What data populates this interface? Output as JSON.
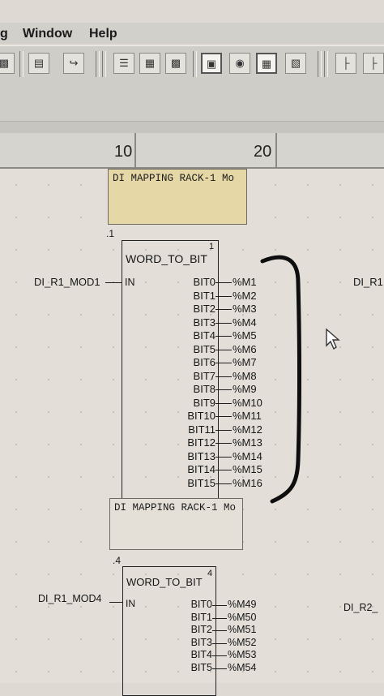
{
  "menu": {
    "items": [
      "g",
      "Window",
      "Help"
    ]
  },
  "toolbar": {
    "icons": [
      "console-icon",
      "print-icon",
      "import-icon",
      "layers-icon",
      "grid-icon",
      "grid-small-icon",
      "monitor-icon",
      "binoculars-icon",
      "table-icon",
      "save-icon",
      "tree-icon",
      "tree-alt-icon"
    ]
  },
  "ruler": {
    "marks": [
      "10",
      "20"
    ]
  },
  "comments": {
    "top": "DI MAPPING RACK-1 Mo",
    "middle": "DI MAPPING RACK-1 Mo"
  },
  "block1": {
    "rung_label": ".1",
    "name": "WORD_TO_BIT",
    "instance": "1",
    "input_label": "IN",
    "input_var": "DI_R1_MOD1",
    "right_var": "DI_R1",
    "pins": [
      {
        "bit": "BIT0",
        "mem": "%M1"
      },
      {
        "bit": "BIT1",
        "mem": "%M2"
      },
      {
        "bit": "BIT2",
        "mem": "%M3"
      },
      {
        "bit": "BIT3",
        "mem": "%M4"
      },
      {
        "bit": "BIT4",
        "mem": "%M5"
      },
      {
        "bit": "BIT5",
        "mem": "%M6"
      },
      {
        "bit": "BIT6",
        "mem": "%M7"
      },
      {
        "bit": "BIT7",
        "mem": "%M8"
      },
      {
        "bit": "BIT8",
        "mem": "%M9"
      },
      {
        "bit": "BIT9",
        "mem": "%M10"
      },
      {
        "bit": "BIT10",
        "mem": "%M11"
      },
      {
        "bit": "BIT11",
        "mem": "%M12"
      },
      {
        "bit": "BIT12",
        "mem": "%M13"
      },
      {
        "bit": "BIT13",
        "mem": "%M14"
      },
      {
        "bit": "BIT14",
        "mem": "%M15"
      },
      {
        "bit": "BIT15",
        "mem": "%M16"
      }
    ]
  },
  "block2": {
    "rung_label": ".4",
    "name": "WORD_TO_BIT",
    "instance": "4",
    "input_label": "IN",
    "input_var": "DI_R1_MOD4",
    "right_var": "DI_R2_",
    "pins": [
      {
        "bit": "BIT0",
        "mem": "%M49"
      },
      {
        "bit": "BIT1",
        "mem": "%M50"
      },
      {
        "bit": "BIT2",
        "mem": "%M51"
      },
      {
        "bit": "BIT3",
        "mem": "%M52"
      },
      {
        "bit": "BIT4",
        "mem": "%M53"
      },
      {
        "bit": "BIT5",
        "mem": "%M54"
      }
    ]
  }
}
